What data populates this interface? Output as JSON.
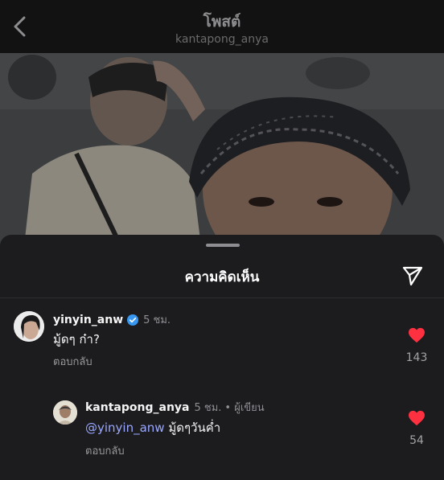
{
  "header": {
    "title": "โพสต์",
    "subtitle": "kantapong_anya"
  },
  "sheet": {
    "title": "ความคิดเห็น"
  },
  "comments": [
    {
      "username": "yinyin_anw",
      "verified": true,
      "time": "5 ชม.",
      "text": "มู้ดๆ ก๋า?",
      "reply_label": "ตอบกลับ",
      "likes": "143"
    },
    {
      "username": "kantapong_anya",
      "time": "5 ชม.",
      "author_tag": "• ผู้เขียน",
      "mention": "@yinyin_anw",
      "text": "มู้ดๆวันค่ำ",
      "reply_label": "ตอบกลับ",
      "likes": "54"
    }
  ],
  "colors": {
    "like": "#ff3040",
    "verified": "#3897f0",
    "mention": "#9aa8ff",
    "sheet_bg": "#1c1c1e"
  },
  "icons": {
    "back": "chevron-left-icon",
    "share": "paper-plane-icon",
    "verified": "verified-badge-icon",
    "like": "heart-icon"
  }
}
